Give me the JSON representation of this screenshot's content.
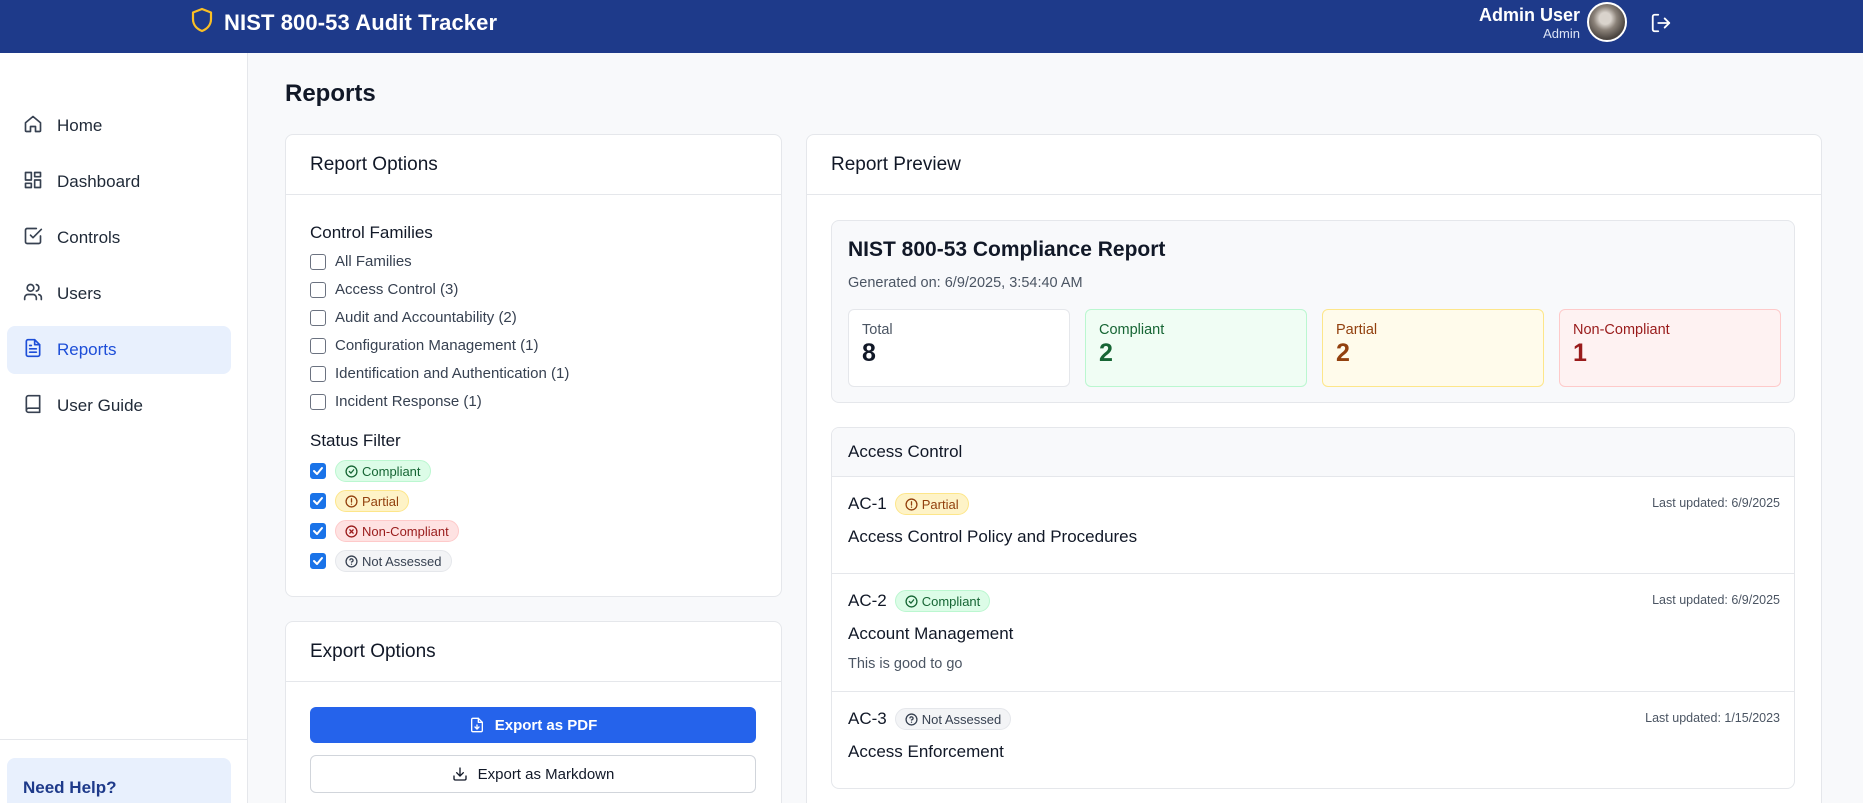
{
  "app": {
    "title": "NIST 800-53 Audit Tracker",
    "user_name": "Admin User",
    "user_role": "Admin"
  },
  "sidebar": {
    "items": [
      {
        "label": "Home",
        "icon": "home-icon"
      },
      {
        "label": "Dashboard",
        "icon": "dashboard-icon"
      },
      {
        "label": "Controls",
        "icon": "check-square-icon"
      },
      {
        "label": "Users",
        "icon": "users-icon"
      },
      {
        "label": "Reports",
        "icon": "file-text-icon",
        "active": true
      },
      {
        "label": "User Guide",
        "icon": "book-icon"
      }
    ],
    "help_title": "Need Help?"
  },
  "page": {
    "title": "Reports"
  },
  "report_options": {
    "title": "Report Options",
    "families_title": "Control Families",
    "families": [
      {
        "label": "All Families",
        "checked": false
      },
      {
        "label": "Access Control (3)",
        "checked": false
      },
      {
        "label": "Audit and Accountability (2)",
        "checked": false
      },
      {
        "label": "Configuration Management (1)",
        "checked": false
      },
      {
        "label": "Identification and Authentication (1)",
        "checked": false
      },
      {
        "label": "Incident Response (1)",
        "checked": false
      }
    ],
    "status_title": "Status Filter",
    "statuses": [
      {
        "label": "Compliant",
        "checked": true,
        "kind": "compliant"
      },
      {
        "label": "Partial",
        "checked": true,
        "kind": "partial"
      },
      {
        "label": "Non-Compliant",
        "checked": true,
        "kind": "noncompliant"
      },
      {
        "label": "Not Assessed",
        "checked": true,
        "kind": "notassessed"
      }
    ]
  },
  "export_options": {
    "title": "Export Options",
    "pdf_label": "Export as PDF",
    "markdown_label": "Export as Markdown"
  },
  "preview": {
    "title": "Report Preview",
    "report_title": "NIST 800-53 Compliance Report",
    "generated": "Generated on: 6/9/2025, 3:54:40 AM",
    "stats": [
      {
        "label": "Total",
        "value": "8",
        "kind": "total"
      },
      {
        "label": "Compliant",
        "value": "2",
        "kind": "compliant"
      },
      {
        "label": "Partial",
        "value": "2",
        "kind": "partial"
      },
      {
        "label": "Non-Compliant",
        "value": "1",
        "kind": "noncompliant"
      }
    ],
    "family_name": "Access Control",
    "controls": [
      {
        "id": "AC-1",
        "status": "Partial",
        "kind": "partial",
        "updated": "Last updated: 6/9/2025",
        "title": "Access Control Policy and Procedures",
        "note": ""
      },
      {
        "id": "AC-2",
        "status": "Compliant",
        "kind": "compliant",
        "updated": "Last updated: 6/9/2025",
        "title": "Account Management",
        "note": "This is good to go"
      },
      {
        "id": "AC-3",
        "status": "Not Assessed",
        "kind": "notassessed",
        "updated": "Last updated: 1/15/2023",
        "title": "Access Enforcement",
        "note": ""
      }
    ]
  },
  "colors": {
    "topbar": "#1e3a8a",
    "primary": "#2563eb",
    "active_nav_bg": "#e8f0fd"
  }
}
